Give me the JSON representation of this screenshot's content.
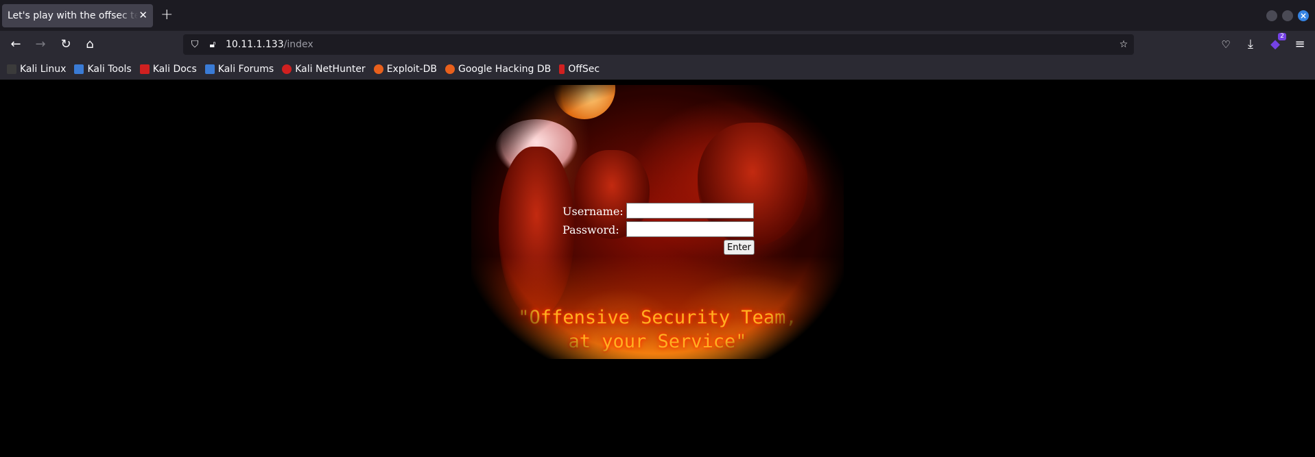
{
  "tab": {
    "title": "Let's play with the offsec team"
  },
  "navbar": {
    "url_host": "10.11.1.133",
    "url_path": "/index",
    "extension_badge": "2"
  },
  "bookmarks": [
    {
      "label": "Kali Linux",
      "color": "#3b3b3b"
    },
    {
      "label": "Kali Tools",
      "color": "#3a7bd5"
    },
    {
      "label": "Kali Docs",
      "color": "#d02020"
    },
    {
      "label": "Kali Forums",
      "color": "#3a7bd5"
    },
    {
      "label": "Kali NetHunter",
      "color": "#d02020"
    },
    {
      "label": "Exploit-DB",
      "color": "#e8601c"
    },
    {
      "label": "Google Hacking DB",
      "color": "#e8601c"
    },
    {
      "label": "OffSec",
      "color": "#d02020"
    }
  ],
  "login": {
    "username_label": "Username:",
    "username_value": "",
    "password_label": "Password:",
    "password_value": "",
    "enter_label": "Enter"
  },
  "banner": {
    "line1": "\"Offensive Security Team,",
    "line2": "at your Service\""
  }
}
